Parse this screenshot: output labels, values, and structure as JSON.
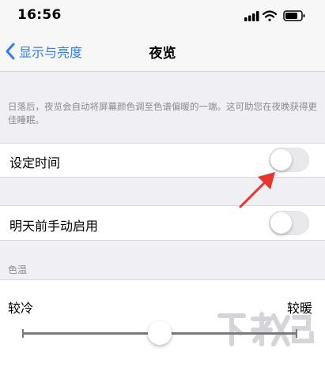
{
  "status": {
    "time": "16:56"
  },
  "nav": {
    "back_label": "显示与亮度",
    "title": "夜览"
  },
  "description": "日落后，夜览会自动将屏幕颜色调至色谱偏暖的一端。这可助您在夜晚获得更佳睡眠。",
  "rows": {
    "scheduled": {
      "label": "设定时间",
      "enabled": false
    },
    "manual": {
      "label": "明天前手动启用",
      "enabled": false
    }
  },
  "color_temp": {
    "header": "色温",
    "min_label": "较冷",
    "max_label": "较暖",
    "value": 0.5
  },
  "watermark": "下载吧",
  "colors": {
    "accent": "#2f7cf6",
    "arrow": "#e8352e",
    "toggle_off": "#e9e9eb"
  }
}
